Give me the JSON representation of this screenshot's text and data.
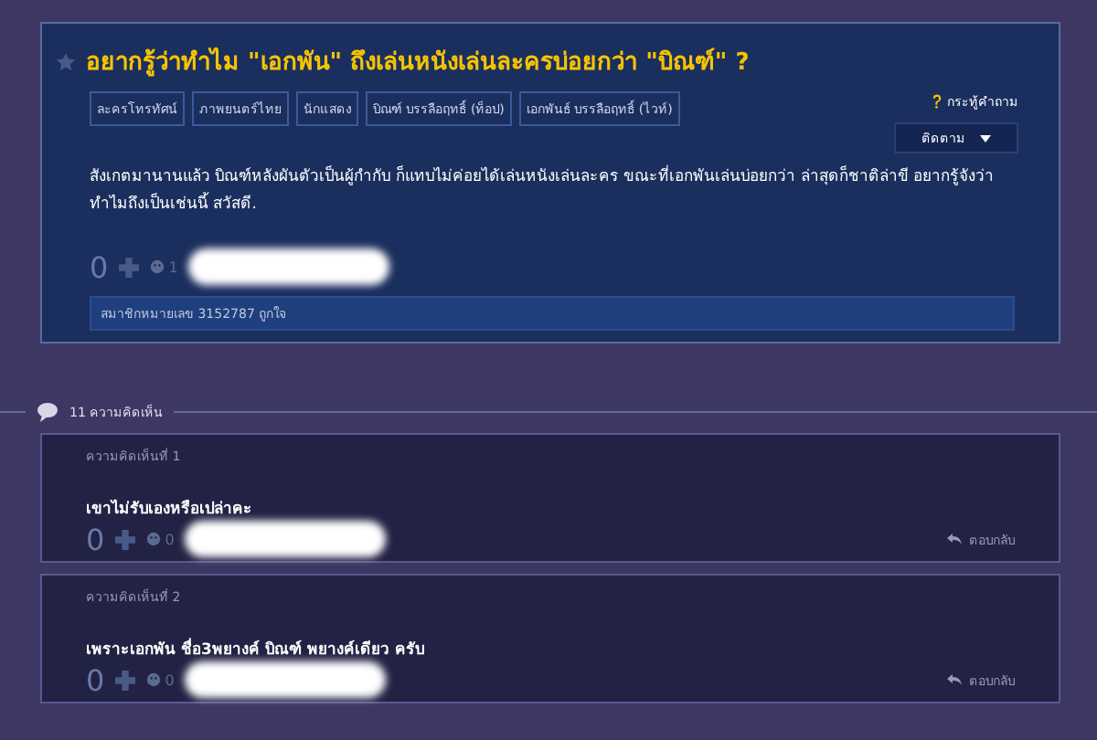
{
  "topic": {
    "title": "อยากรู้ว่าทำไม \"เอกพัน\" ถึงเล่นหนังเล่นละครบ่อยกว่า \"บิณฑ์\" ?",
    "tags": [
      "ละครโทรทัศน์",
      "ภาพยนตร์ไทย",
      "นักแสดง",
      "บิณฑ์ บรรลือฤทธิ์ (ท็อป)",
      "เอกพันธ์ บรรลือฤทธิ์ (ไวท์)"
    ],
    "type_label": "กระทู้คำถาม",
    "follow_button": "ติดตาม",
    "body": "สังเกตมานานแล้ว บิณฑ์หลังผันตัวเป็นผู้กำกับ ก็แทบไม่ค่อยได้เล่นหนังเล่นละคร ขณะที่เอกพันเล่นบ่อยกว่า ล่าสุดก็ชาติล่าขี อยากรู้จังว่าทำไมถึงเป็นเช่นนี้ สวัสดี.",
    "votes": "0",
    "emotions": "1",
    "liked_by": "สมาชิกหมายเลข 3152787 ถูกใจ"
  },
  "comments_header": "11 ความคิดเห็น",
  "comments": [
    {
      "label": "ความคิดเห็นที่ 1",
      "text": "เขาไม่รับเองหรือเปล่าคะ",
      "votes": "0",
      "emotions": "0",
      "reply": "ตอบกลับ"
    },
    {
      "label": "ความคิดเห็นที่ 2",
      "text": "เพราะเอกพัน ชื่อ3พยางค์ บิณฑ์ พยางค์เดียว ครับ",
      "votes": "0",
      "emotions": "0",
      "reply": "ตอบกลับ"
    }
  ]
}
